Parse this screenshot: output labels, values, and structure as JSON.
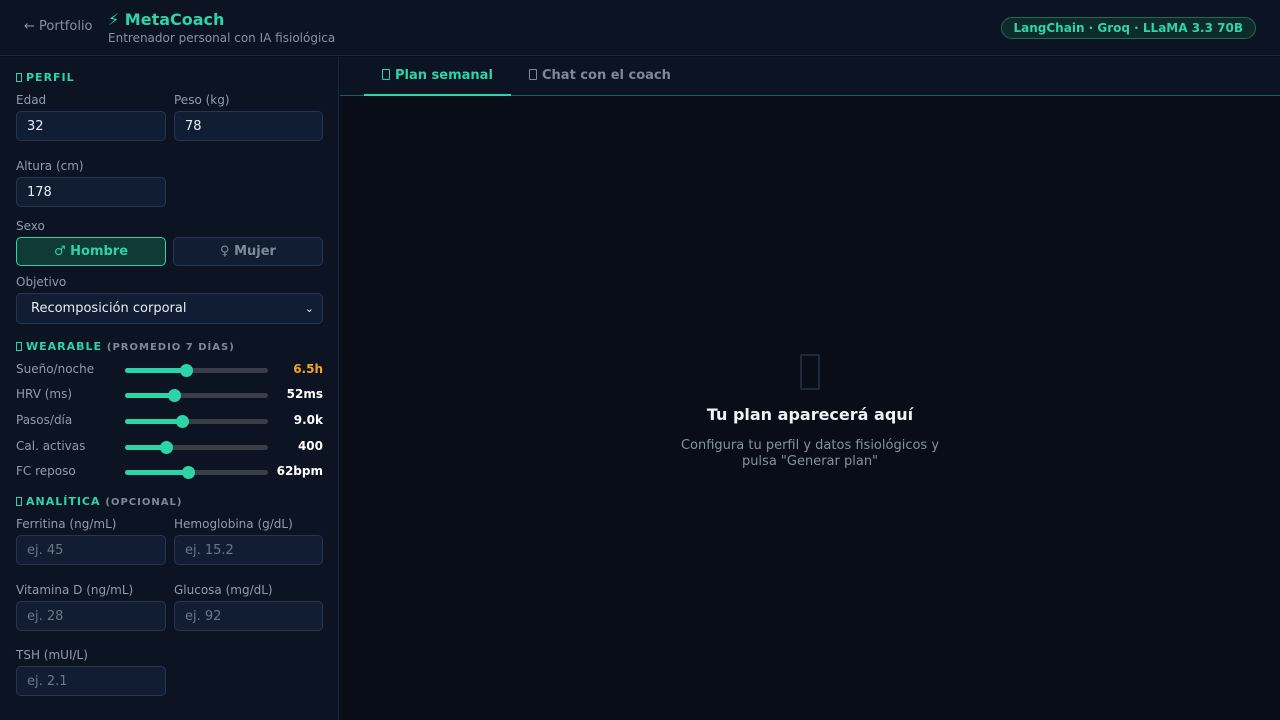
{
  "header": {
    "back_label": "← Portfolio",
    "title": "⚡ MetaCoach",
    "subtitle": "Entrenador personal con IA fisiológica",
    "badge": "LangChain · Groq · LLaMA 3.3 70B",
    "accent_color": "#2dd4a7"
  },
  "profile": {
    "section_title": "PERFIL",
    "age_label": "Edad",
    "age_value": "32",
    "weight_label": "Peso (kg)",
    "weight_value": "78",
    "height_label": "Altura (cm)",
    "height_value": "178",
    "sex_label": "Sexo",
    "sex_male": "♂ Hombre",
    "sex_female": "♀ Mujer",
    "sex_selected": "male",
    "goal_label": "Objetivo",
    "goal_value": "Recomposición corporal"
  },
  "wearable": {
    "section_title": "WEARABLE",
    "section_note": "(PROMEDIO 7 DÍAS)",
    "sliders": [
      {
        "label": "Sueño/noche",
        "value": "6.5h",
        "level": 0.43,
        "warn": true
      },
      {
        "label": "HRV (ms)",
        "value": "52ms",
        "level": 0.34,
        "warn": false
      },
      {
        "label": "Pasos/día",
        "value": "9.0k",
        "level": 0.4,
        "warn": false
      },
      {
        "label": "Cal. activas",
        "value": "400",
        "level": 0.29,
        "warn": false
      },
      {
        "label": "FC reposo",
        "value": "62bpm",
        "level": 0.44,
        "warn": false
      }
    ]
  },
  "labs": {
    "section_title": "ANALÍTICA",
    "section_note": "(OPCIONAL)",
    "ferritin_label": "Ferritina (ng/mL)",
    "ferritin_placeholder": "ej. 45",
    "hemoglobin_label": "Hemoglobina (g/dL)",
    "hemoglobin_placeholder": "ej. 15.2",
    "vitd_label": "Vitamina D (ng/mL)",
    "vitd_placeholder": "ej. 28",
    "glucose_label": "Glucosa (mg/dL)",
    "glucose_placeholder": "ej. 92",
    "tsh_label": "TSH (mUI/L)",
    "tsh_placeholder": "ej. 2.1"
  },
  "tabs": {
    "plan": "Plan semanal",
    "chat": "Chat con el coach",
    "plan_icon": "calendar-icon",
    "chat_icon": "chat-icon"
  },
  "empty_state": {
    "icon": "clipboard-icon",
    "title": "Tu plan aparecerá aquí",
    "subtitle": "Configura tu perfil y datos fisiológicos y pulsa \"Generar plan\""
  }
}
